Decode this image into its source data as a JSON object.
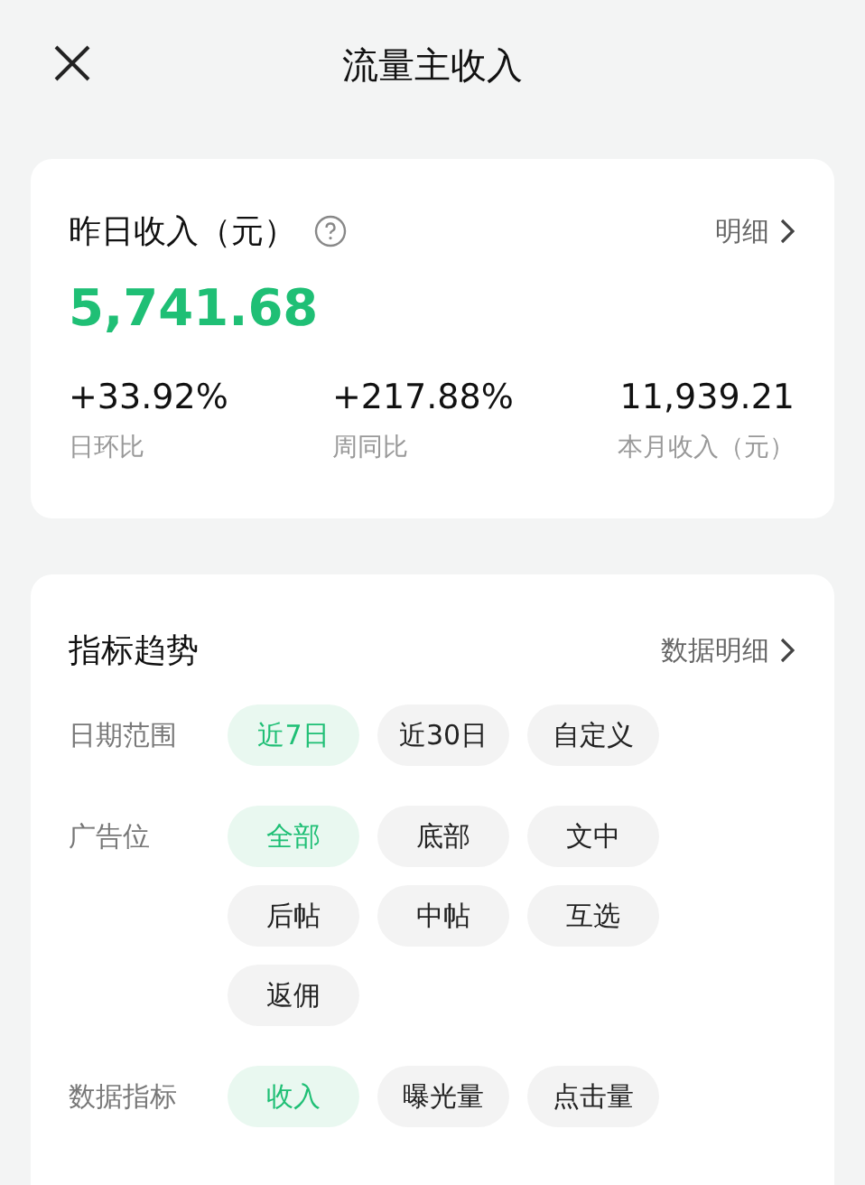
{
  "header": {
    "title": "流量主收入"
  },
  "income": {
    "title": "昨日收入（元）",
    "detail_link": "明细",
    "amount": "5,741.68",
    "stats": [
      {
        "value": "+33.92%",
        "label": "日环比"
      },
      {
        "value": "+217.88%",
        "label": "周同比"
      },
      {
        "value": "11,939.21",
        "label": "本月收入（元）"
      }
    ]
  },
  "trend": {
    "title": "指标趋势",
    "detail_link": "数据明细",
    "filters": [
      {
        "label": "日期范围",
        "options": [
          {
            "text": "近7日",
            "selected": true
          },
          {
            "text": "近30日",
            "selected": false
          },
          {
            "text": "自定义",
            "selected": false
          }
        ]
      },
      {
        "label": "广告位",
        "options": [
          {
            "text": "全部",
            "selected": true
          },
          {
            "text": "底部",
            "selected": false
          },
          {
            "text": "文中",
            "selected": false
          },
          {
            "text": "后帖",
            "selected": false
          },
          {
            "text": "中帖",
            "selected": false
          },
          {
            "text": "互选",
            "selected": false
          },
          {
            "text": "返佣",
            "selected": false
          }
        ]
      },
      {
        "label": "数据指标",
        "options": [
          {
            "text": "收入",
            "selected": true
          },
          {
            "text": "曝光量",
            "selected": false
          },
          {
            "text": "点击量",
            "selected": false
          }
        ]
      }
    ]
  }
}
